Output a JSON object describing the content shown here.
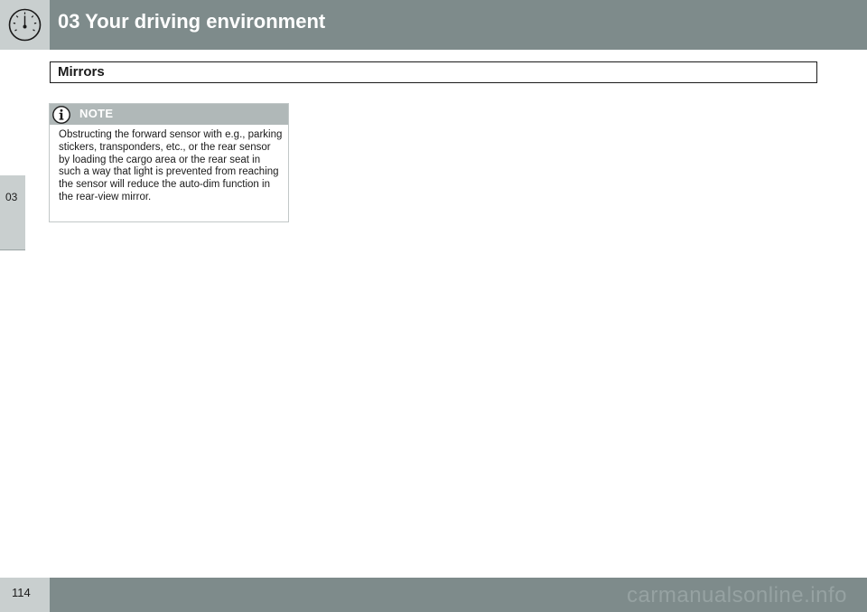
{
  "header": {
    "chapter_title": "03 Your driving environment",
    "icon": "gauge-icon"
  },
  "side_tab": {
    "label": "03"
  },
  "section": {
    "title": "Mirrors"
  },
  "note": {
    "icon": "info-icon",
    "label": "NOTE",
    "text": "Obstructing the forward sensor with e.g., parking stickers, transponders, etc., or the rear sensor by loading the cargo area or the rear seat in such a way that light is prevented from reaching the sensor will reduce the auto-dim function in the rear-view mirror."
  },
  "footer": {
    "page_number": "114",
    "watermark": "carmanualsonline.info"
  },
  "colors": {
    "header_bar": "#7e8b8b",
    "light_panel": "#c9cfcf",
    "note_header": "#b0b8b8"
  }
}
